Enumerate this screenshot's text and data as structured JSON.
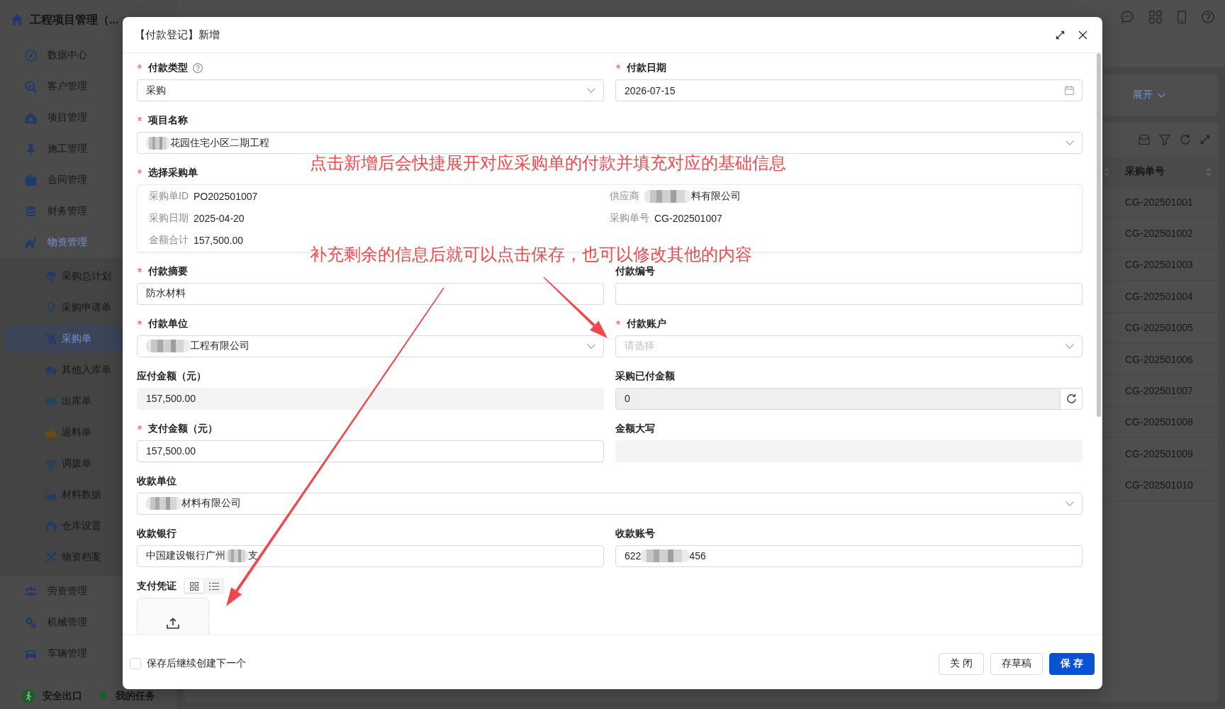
{
  "sidebar": {
    "app_title": "工程项目管理（...",
    "items": [
      {
        "label": "数据中心",
        "selected": false
      },
      {
        "label": "客户管理",
        "selected": false
      },
      {
        "label": "项目管理",
        "selected": false
      },
      {
        "label": "施工管理",
        "selected": false
      },
      {
        "label": "合同管理",
        "selected": false
      },
      {
        "label": "财务管理",
        "selected": false
      },
      {
        "label": "物资管理",
        "selected": false,
        "expanded": true,
        "children": [
          {
            "label": "采购总计划",
            "selected": false
          },
          {
            "label": "采购申请单",
            "selected": false
          },
          {
            "label": "采购单",
            "selected": true
          },
          {
            "label": "其他入库单",
            "selected": false
          },
          {
            "label": "出库单",
            "selected": false
          },
          {
            "label": "退料单",
            "selected": false
          },
          {
            "label": "调拨单",
            "selected": false
          },
          {
            "label": "材料数据",
            "selected": false
          },
          {
            "label": "仓库设置",
            "selected": false
          },
          {
            "label": "物资档案",
            "selected": false
          }
        ]
      },
      {
        "label": "劳资管理",
        "selected": false
      },
      {
        "label": "机械管理",
        "selected": false
      },
      {
        "label": "车辆管理",
        "selected": false
      }
    ],
    "footer_links": [
      "安全出口",
      "我的任务"
    ]
  },
  "search_panel": {
    "expand_link": "展开"
  },
  "table": {
    "columns": [
      "采购单号"
    ],
    "rows": [
      [
        "CG-202501001"
      ],
      [
        "CG-202501002"
      ],
      [
        "CG-202501003"
      ],
      [
        "CG-202501004"
      ],
      [
        "CG-202501005"
      ],
      [
        "CG-202501006"
      ],
      [
        "CG-202501007"
      ],
      [
        "CG-202501008"
      ],
      [
        "CG-202501009"
      ],
      [
        "CG-202501010"
      ]
    ]
  },
  "dialog": {
    "title": "【付款登记】新增",
    "rows": [
      [
        {
          "kind": "select",
          "label": "付款类型",
          "required": true,
          "help": true,
          "disabled": false,
          "value": "采购"
        },
        {
          "kind": "date",
          "label": "付款日期",
          "required": true,
          "disabled": false,
          "value": "2026-07-15"
        }
      ],
      [
        {
          "kind": "select",
          "label": "项目名称",
          "required": true,
          "disabled": false,
          "value": [
            {
              "kind": "redacted"
            },
            {
              "kind": "text",
              "text": "花园住宅小区二期工程"
            }
          ]
        }
      ],
      [
        {
          "kind": "order",
          "label": "选择采购单",
          "required": true,
          "disabled": false,
          "details": [
            {
              "label": "采购单ID",
              "value": "PO202501007"
            },
            {
              "label": "供应商",
              "value": [
                {
                  "kind": "redacted"
                },
                {
                  "kind": "text",
                  "text": "料有限公司"
                }
              ]
            },
            {
              "label": "采购日期",
              "value": "2025-04-20"
            },
            {
              "label": "采购单号",
              "value": "CG-202501007"
            },
            {
              "label": "金额合计",
              "value": "157,500.00"
            }
          ]
        }
      ],
      [
        {
          "kind": "text",
          "label": "付款摘要",
          "required": true,
          "disabled": false,
          "value": "防水材料"
        },
        {
          "kind": "text",
          "label": "付款编号",
          "required": false,
          "disabled": false
        }
      ],
      [
        {
          "kind": "select",
          "label": "付款单位",
          "required": true,
          "disabled": false,
          "value": [
            {
              "kind": "redacted"
            },
            {
              "kind": "text",
              "text": "工程有限公司"
            }
          ]
        },
        {
          "kind": "select",
          "label": "付款账户",
          "required": true,
          "disabled": false,
          "placeholder": "请选择"
        }
      ],
      [
        {
          "kind": "text",
          "label": "应付金额（元）",
          "required": false,
          "disabled": true,
          "value": "157,500.00"
        },
        {
          "kind": "refresh",
          "label": "采购已付金额",
          "required": false,
          "disabled": true,
          "value": "0"
        }
      ],
      [
        {
          "kind": "text",
          "label": "支付金额（元）",
          "required": true,
          "disabled": false,
          "value": "157,500.00"
        },
        {
          "kind": "text",
          "label": "金额大写",
          "required": false,
          "disabled": true
        }
      ],
      [
        {
          "kind": "select",
          "label": "收款单位",
          "required": false,
          "disabled": false,
          "value": [
            {
              "kind": "redacted"
            },
            {
              "kind": "text",
              "text": "材料有限公司"
            }
          ]
        }
      ],
      [
        {
          "kind": "text",
          "label": "收款银行",
          "required": false,
          "disabled": false,
          "value": [
            {
              "kind": "text",
              "text": "中国建设银行广州"
            },
            {
              "kind": "redacted"
            },
            {
              "kind": "text",
              "text": "支"
            }
          ]
        },
        {
          "kind": "text",
          "label": "收款账号",
          "required": false,
          "disabled": false,
          "value": [
            {
              "kind": "text",
              "text": "622"
            },
            {
              "kind": "redacted"
            },
            {
              "kind": "text",
              "text": "456"
            }
          ]
        }
      ],
      [
        {
          "kind": "upload",
          "label": "支付凭证",
          "required": false,
          "disabled": false,
          "views": [
            {
              "kind": "grid",
              "selected": true
            },
            {
              "kind": "list",
              "selected": false
            }
          ]
        }
      ]
    ],
    "continue_option": {
      "label": "保存后继续创建下一个",
      "checked": false
    },
    "buttons": [
      {
        "label": "关 闭",
        "kind": "default"
      },
      {
        "label": "存草稿",
        "kind": "default"
      },
      {
        "label": "保 存",
        "kind": "primary"
      }
    ]
  },
  "annotations": [
    {
      "text": "点击新增后会快捷展开对应采购单的付款并填充对应的基础信息"
    },
    {
      "text": "补充剩余的信息后就可以点击保存，也可以修改其他的内容"
    }
  ]
}
